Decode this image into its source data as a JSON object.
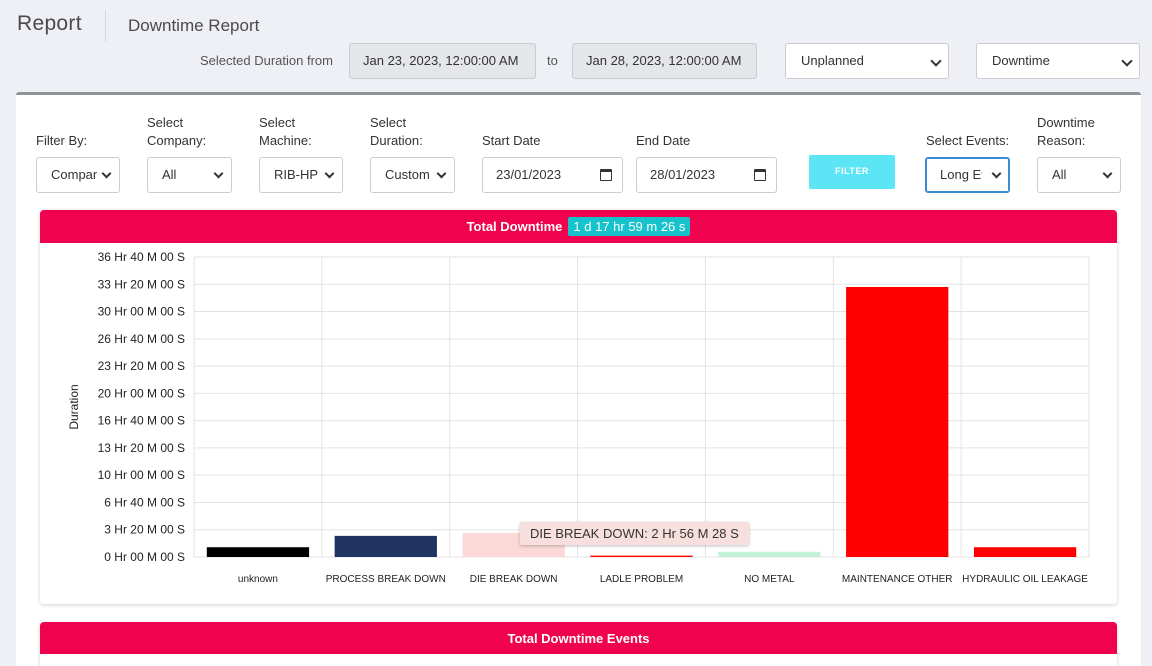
{
  "header": {
    "title": "Report",
    "subtitle": "Downtime Report",
    "duration_label": "Selected Duration from",
    "from_value": "Jan 23, 2023, 12:00:00 AM",
    "to_label": "to",
    "to_value": "Jan 28, 2023, 12:00:00 AM",
    "type_select": "Unplanned",
    "metric_select": "Downtime"
  },
  "filters": {
    "filter_by_label": "Filter By:",
    "filter_by_value": "Company",
    "company_label_1": "Select",
    "company_label_2": "Company:",
    "company_value": "All",
    "machine_label_1": "Select",
    "machine_label_2": "Machine:",
    "machine_value": "RIB-HP",
    "duration_label_1": "Select",
    "duration_label_2": "Duration:",
    "duration_value": "Custom",
    "start_label": "Start Date",
    "start_value": "23/01/2023",
    "end_label": "End Date",
    "end_value": "28/01/2023",
    "filter_button": "FILTER",
    "events_label": "Select Events:",
    "events_value": "Long Events",
    "reason_label_1": "Downtime",
    "reason_label_2": "Reason:",
    "reason_value": "All"
  },
  "card1": {
    "title": "Total Downtime",
    "total": "1 d 17 hr 59 m 26 s"
  },
  "card2": {
    "title": "Total Downtime Events"
  },
  "tooltip": "DIE BREAK DOWN: 2 Hr 56 M 28 S",
  "colors": {
    "header_bar": "#f0034e",
    "badge": "#16c3cc",
    "filter_button": "#5ce5f5"
  },
  "chart_data": {
    "type": "bar",
    "ylabel": "Duration",
    "xlabel": "",
    "ylim": [
      0,
      132000
    ],
    "yticks": [
      0,
      12000,
      24000,
      36000,
      48000,
      60000,
      72000,
      84000,
      96000,
      108000,
      120000,
      132000
    ],
    "ytick_labels": [
      "0 Hr 00 M 00 S",
      "3 Hr 20 M 00 S",
      "6 Hr 40 M 00 S",
      "10 Hr 00 M 00 S",
      "13 Hr 20 M 00 S",
      "16 Hr 40 M 00 S",
      "20 Hr 00 M 00 S",
      "23 Hr 20 M 00 S",
      "26 Hr 40 M 00 S",
      "30 Hr 00 M 00 S",
      "33 Hr 20 M 00 S",
      "36 Hr 40 M 00 S"
    ],
    "unit": "seconds",
    "categories": [
      "unknown",
      "PROCESS BREAK DOWN",
      "DIE BREAK DOWN",
      "LADLE PROBLEM",
      "NO METAL",
      "MAINTENANCE OTHER",
      "HYDRAULIC OIL LEAKAGE"
    ],
    "values": [
      4300,
      9300,
      10588,
      600,
      2300,
      118800,
      4300
    ],
    "colors": [
      "#000000",
      "#1f3461",
      "#fbd9d6",
      "#ff0000",
      "#c3f3d9",
      "#ff0000",
      "#ff0000"
    ],
    "grid": true,
    "legend": "none"
  }
}
